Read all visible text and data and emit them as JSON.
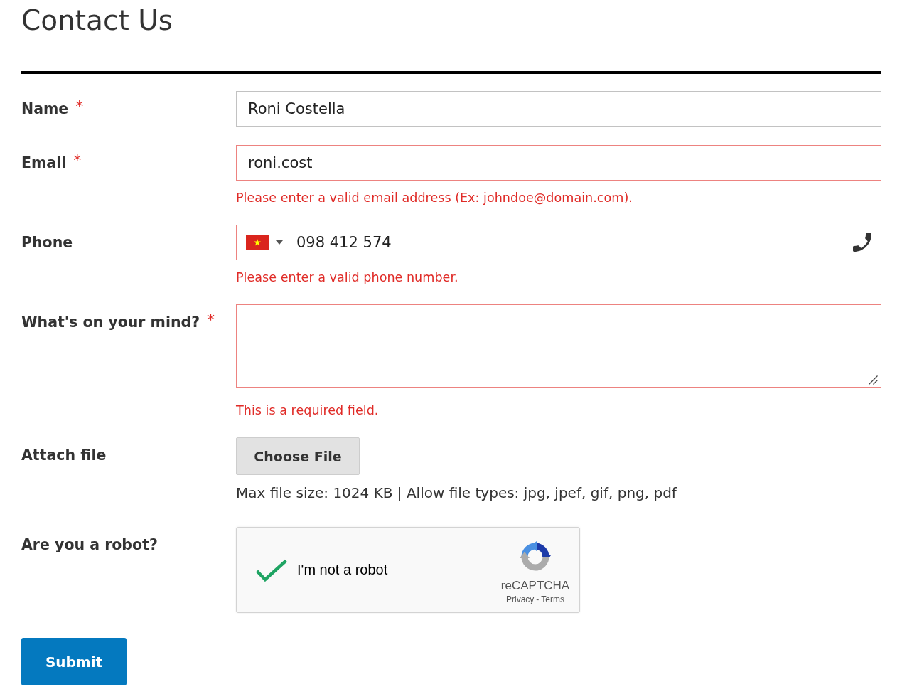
{
  "title": "Contact Us",
  "required_mark": "*",
  "fields": [
    {
      "kind": "text",
      "label": "Name",
      "required": true,
      "value": "Roni Costella",
      "invalid": false
    },
    {
      "kind": "text",
      "label": "Email",
      "required": true,
      "value": "roni.cost",
      "invalid": true,
      "error": "Please enter a valid email address (Ex: johndoe@domain.com)."
    },
    {
      "kind": "phone",
      "label": "Phone",
      "required": false,
      "value": "098 412 574",
      "invalid": true,
      "error": "Please enter a valid phone number."
    },
    {
      "kind": "textarea",
      "label": "What's on your mind?",
      "required": true,
      "invalid": true,
      "error": "This is a required field."
    },
    {
      "kind": "file",
      "label": "Attach file",
      "required": false,
      "button": "Choose File",
      "note": "Max file size: 1024 KB | Allow file types: jpg, jpef, gif, png, pdf"
    },
    {
      "kind": "captcha",
      "label": "Are you a robot?",
      "required": false,
      "checked": true,
      "text": "I'm not a robot",
      "brand": "reCAPTCHA",
      "links": [
        "Privacy",
        "Terms"
      ],
      "link_separator": "-"
    }
  ],
  "submit": "Submit"
}
